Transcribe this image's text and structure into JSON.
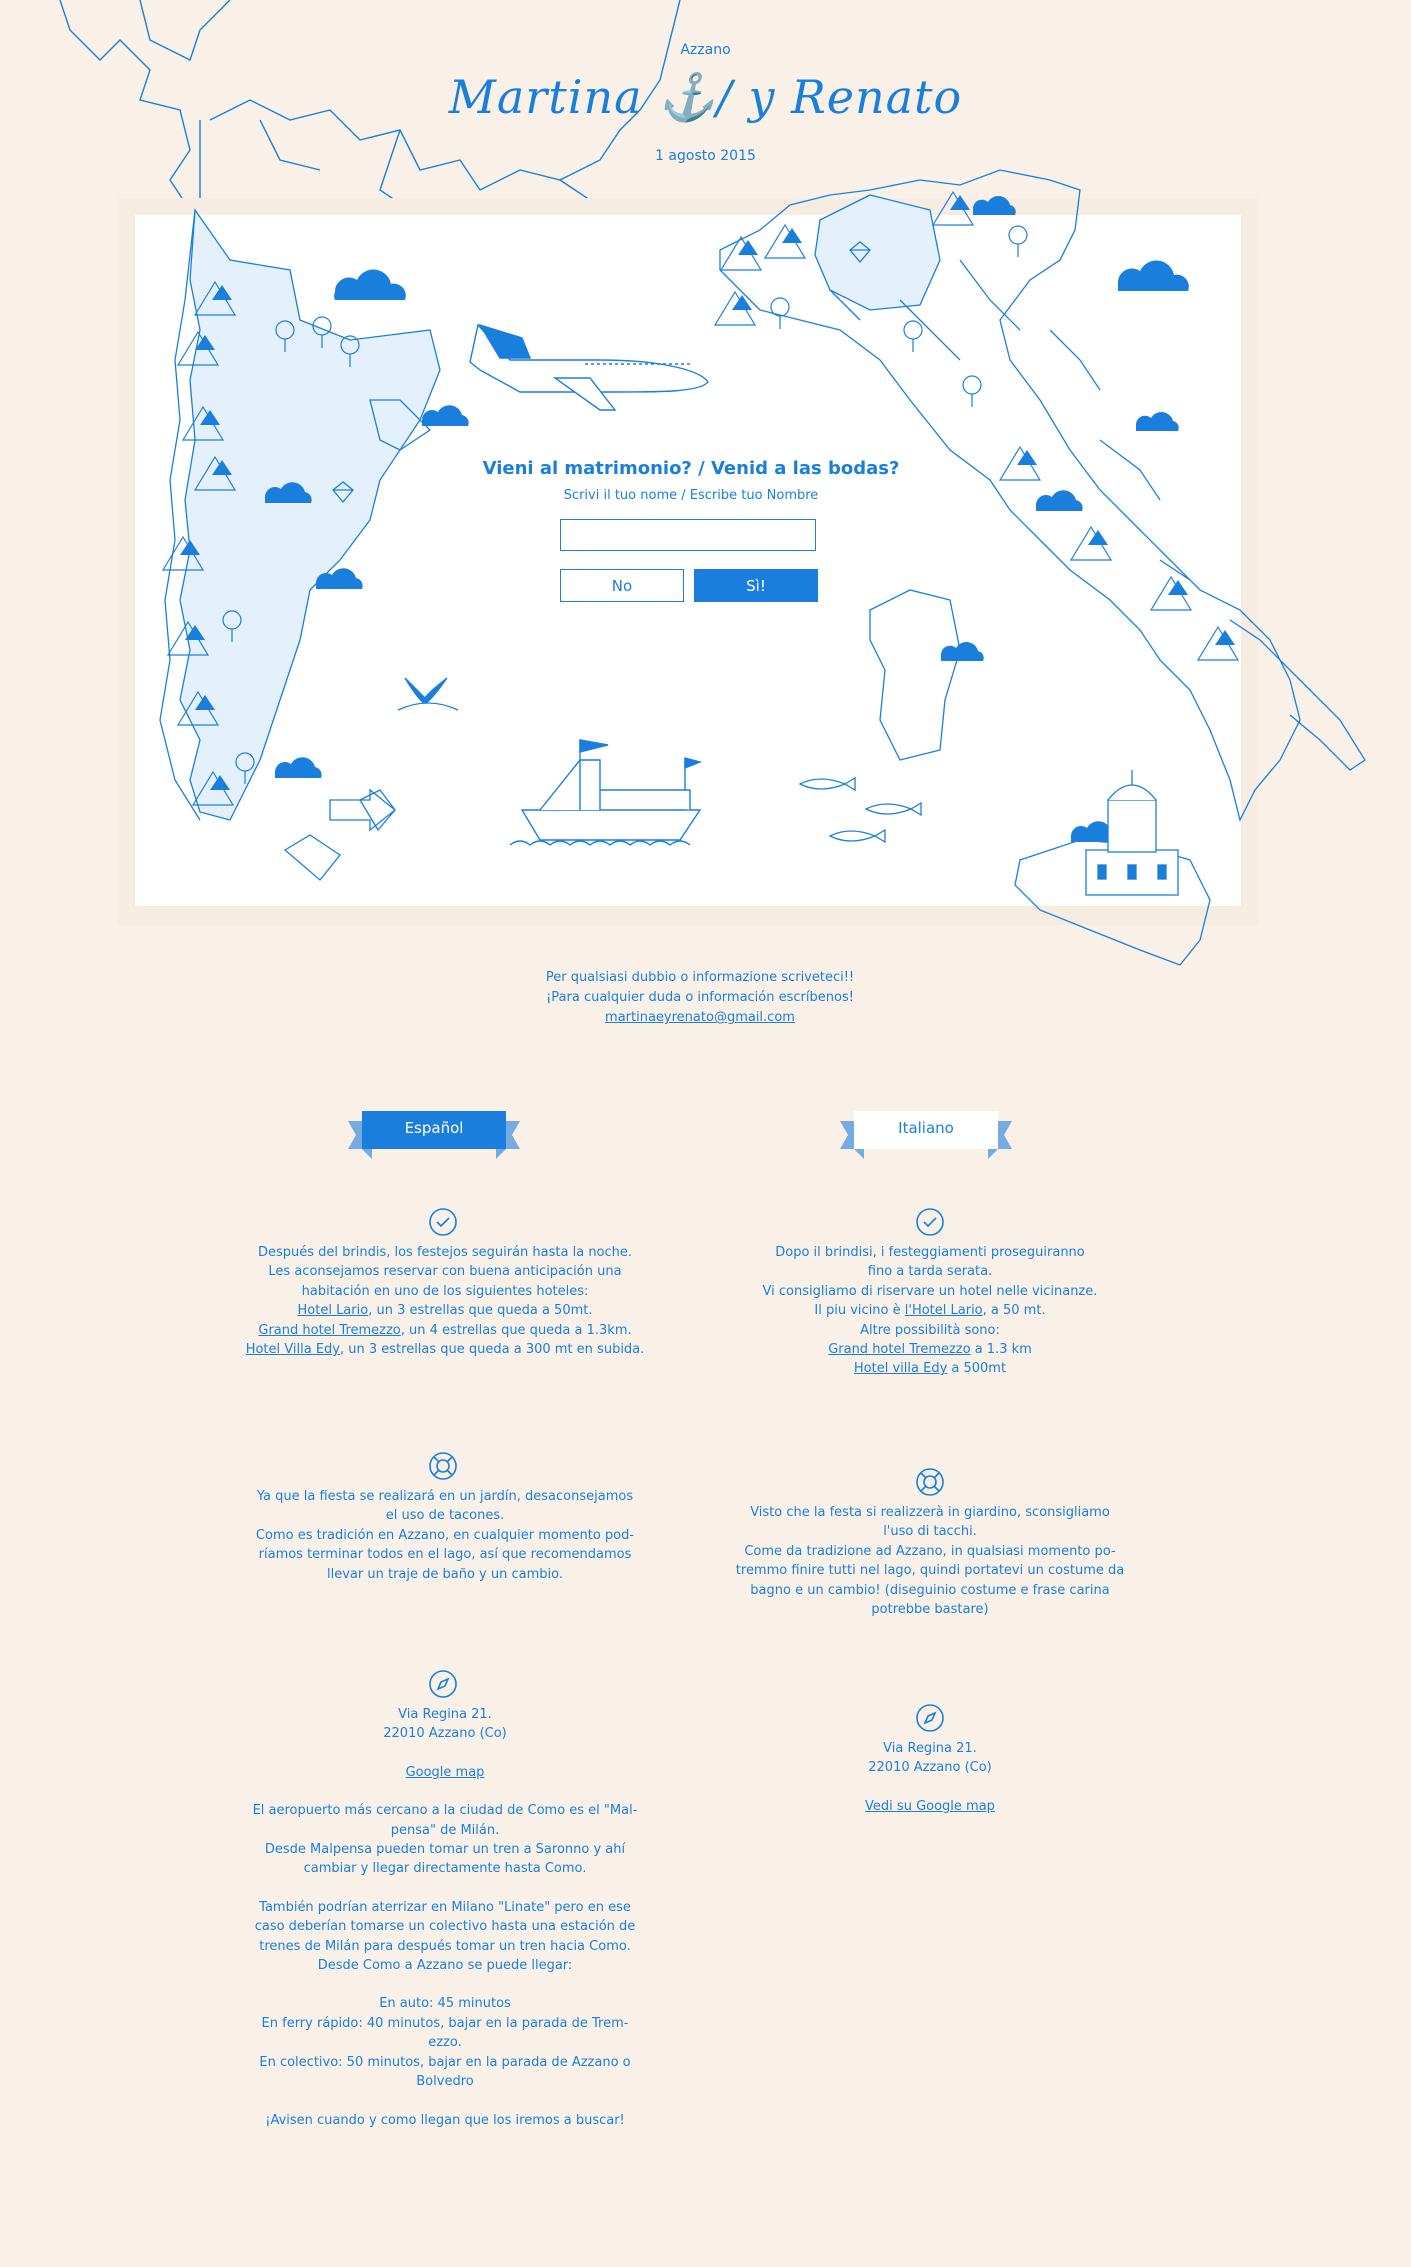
{
  "header": {
    "place": "Azzano",
    "title": "Martina ⚓/ y Renato",
    "date": "1 agosto 2015"
  },
  "form": {
    "question": "Vieni al matrimonio? / Venid a las bodas?",
    "hint": "Scrivi il tuo nome / Escribe tuo Nombre",
    "name_value": "",
    "no_label": "No",
    "yes_label": "Sì!"
  },
  "contact": {
    "line_it": "Per qualsiasi dubbio o informazione scriveteci!!",
    "line_es": "¡Para cualquier duda o información escríbenos!",
    "email": "martinaeyrenato@gmail.com"
  },
  "tabs": {
    "es": "Español",
    "it": "Italiano"
  },
  "colors": {
    "accent": "#1a7fdc",
    "background": "#f9f1e8",
    "land_fill": "#e4f0fb"
  },
  "icons": [
    "check-circle-icon",
    "lifebuoy-icon",
    "compass-icon",
    "cloud-icon",
    "mountain-icon",
    "tree-icon",
    "airplane-icon",
    "ship-icon",
    "fish-icon",
    "whale-tail-icon",
    "church-icon",
    "heart-icon"
  ],
  "es": {
    "hotel": {
      "l1": "Después del brindis, los festejos seguirán hasta la noche.",
      "l2": "Les aconsejamos reservar con buena anticipación una",
      "l3": "habitación en uno de los siguientes hoteles:",
      "h1": "Hotel Lario",
      "h1_rest": ", un 3 estrellas que queda a 50mt.",
      "h2": "Grand hotel Tremezzo",
      "h2_rest": ", un 4 estrellas que queda a 1.3km.",
      "h3": "Hotel Villa Edy",
      "h3_rest": ", un 3 estrellas que queda a 300 mt en subida."
    },
    "party": {
      "l1": "Ya que la fiesta se realizará en un jardín, desaconsejamos",
      "l2": "el uso de tacones.",
      "l3": "Como es tradición en Azzano, en cualquier momento pod-",
      "l4": "ríamos terminar todos en el lago, así que recomendamos",
      "l5": "llevar un traje de baño y un cambio."
    },
    "location": {
      "addr1": "Via Regina 21.",
      "addr2": "22010 Azzano (Co)",
      "map_link": "Google map",
      "p1": "El aeropuerto más cercano a la ciudad de Como es el \"Mal-",
      "p2": "pensa\" de Milán.",
      "p3": "Desde Malpensa pueden tomar un tren a Saronno y ahí",
      "p4": "cambiar y llegar directamente hasta Como.",
      "p5": "También podrían aterrizar en Milano \"Linate\" pero en ese",
      "p6": "caso deberían tomarse un colectivo hasta una estación de",
      "p7": "trenes de Milán para después tomar un tren hacia Como.",
      "p8": "Desde Como a Azzano se puede llegar:",
      "p9": "En auto: 45 minutos",
      "p10": "En ferry rápido: 40 minutos, bajar en la parada de Trem-",
      "p11": "ezzo.",
      "p12": "En colectivo: 50 minutos, bajar en la parada de Azzano o",
      "p13": "Bolvedro",
      "p14": "¡Avisen cuando y como llegan que los iremos a buscar!"
    }
  },
  "it": {
    "hotel": {
      "l1": "Dopo il brindisi, i festeggiamenti proseguiranno",
      "l2": "fino a tarda serata.",
      "l3": "Vi consigliamo di riservare un hotel nelle vicinanze.",
      "l4a": "Il piu vicino è ",
      "l4link": "l'Hotel Lario",
      "l4b": ", a 50 mt.",
      "l5": "Altre possibilità sono:",
      "h2": "Grand hotel Tremezzo",
      "h2_rest": " a 1.3 km",
      "h3": "Hotel villa Edy",
      "h3_rest": " a 500mt"
    },
    "party": {
      "l1": "Visto che la festa si realizzerà in giardino, sconsigliamo",
      "l2": "l'uso di tacchi.",
      "l3": "Come da tradizione ad Azzano, in qualsiasi momento po-",
      "l4": "tremmo finire tutti nel lago, quindi portatevi un costume da",
      "l5": "bagno e un cambio! (diseguinio costume e frase carina",
      "l6": "potrebbe bastare)"
    },
    "location": {
      "addr1": "Via Regina 21.",
      "addr2": "22010 Azzano (Co)",
      "map_link": "Vedi su Google map"
    }
  }
}
